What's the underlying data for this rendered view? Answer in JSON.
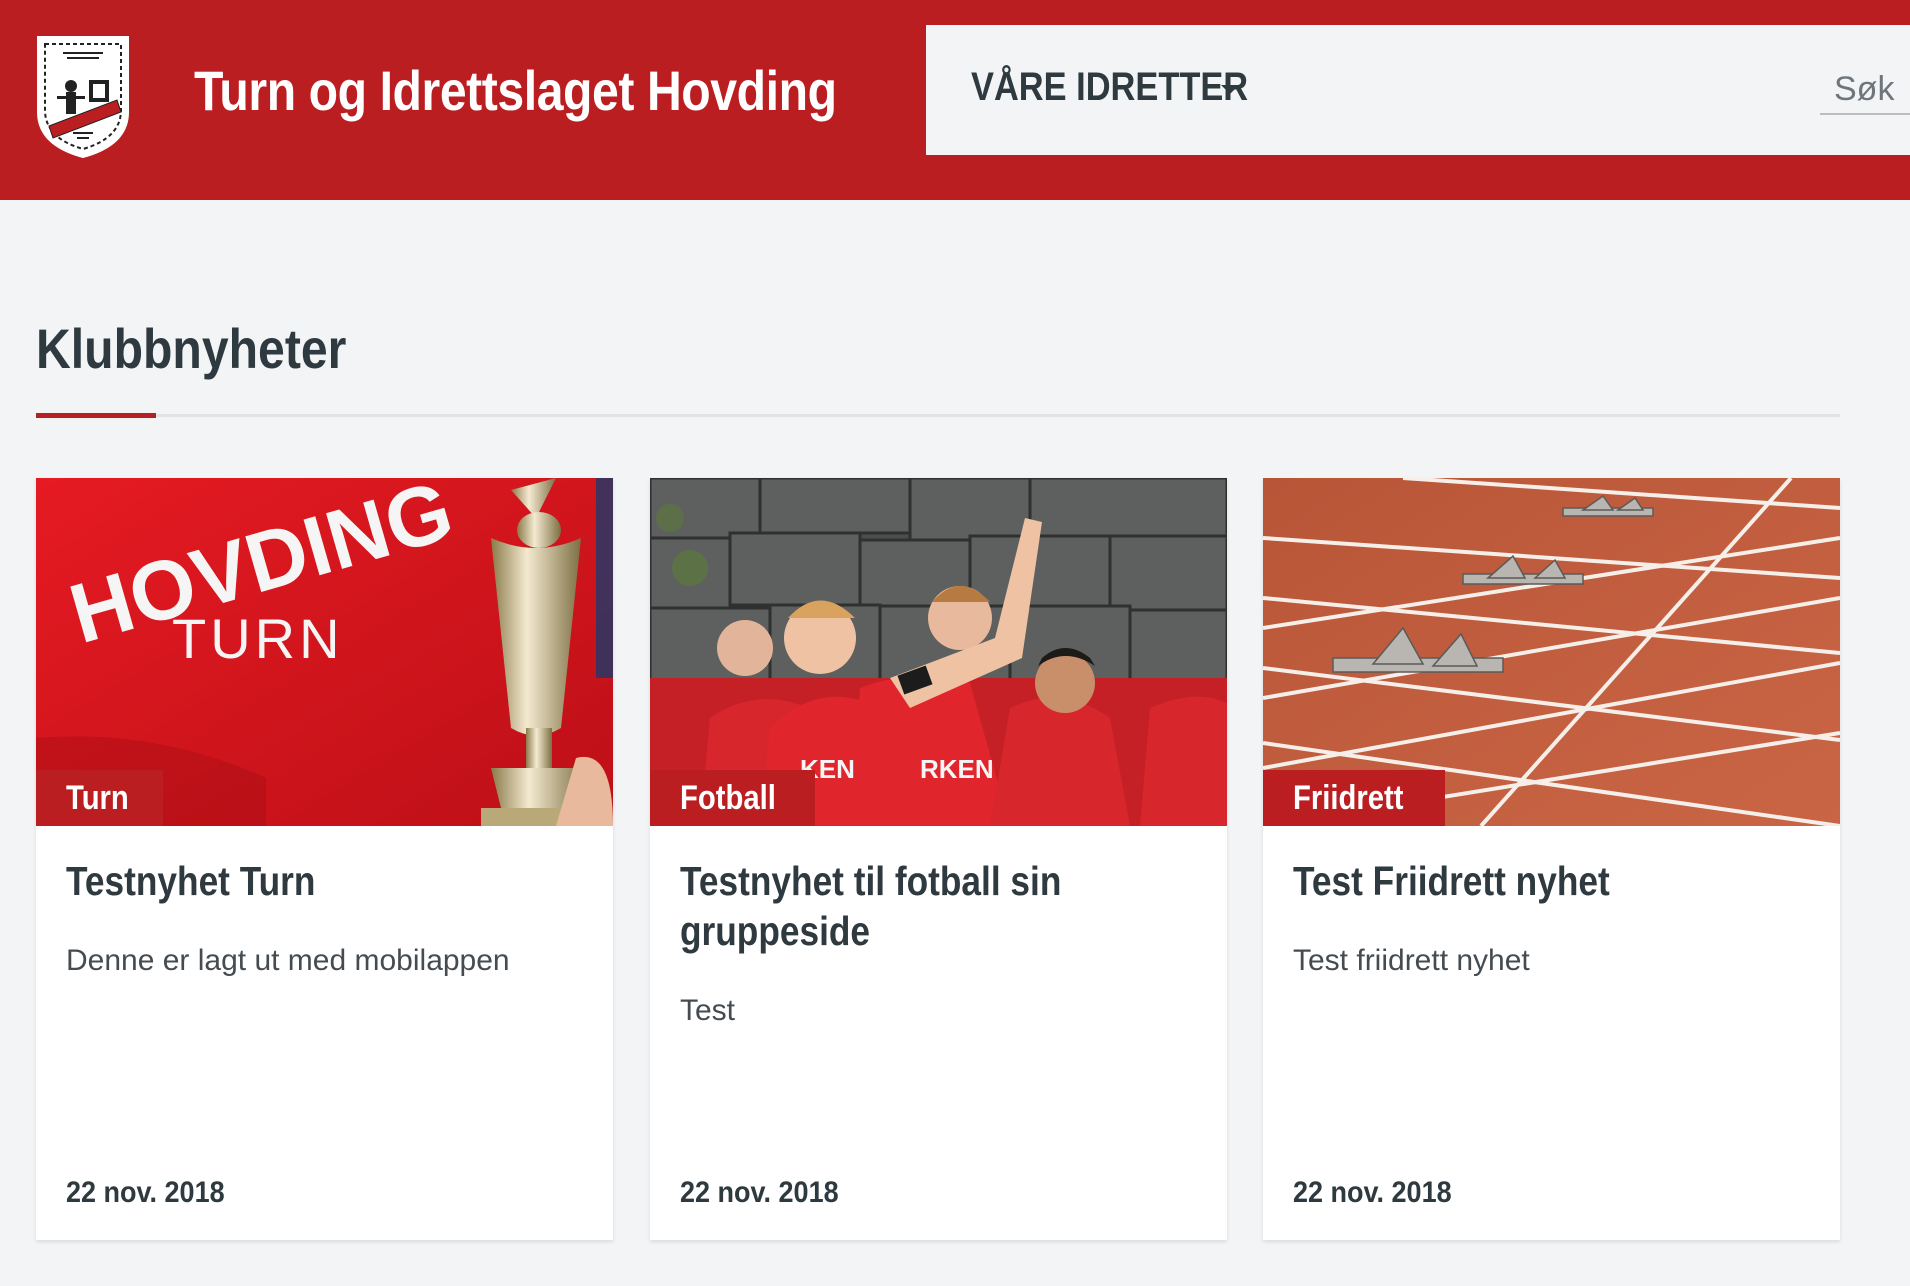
{
  "site": {
    "title": "Turn og Idrettslaget Hovding",
    "logo_icon": "club-crest-icon"
  },
  "nav": {
    "menu_label": "VÅRE IDRETTER",
    "search_placeholder": "Søk"
  },
  "section": {
    "title": "Klubbnyheter"
  },
  "colors": {
    "brand_red": "#bb1e21",
    "text_dark": "#2f3a40",
    "page_bg": "#f3f4f6"
  },
  "news": [
    {
      "tag": "Turn",
      "title": "Testnyhet Turn",
      "excerpt": "Denne er lagt ut med mobilappen",
      "date": "22 nov. 2018",
      "image": "red-jersey-with-trophy-photo",
      "image_text": [
        "HOVDING",
        "TURN"
      ]
    },
    {
      "tag": "Fotball",
      "title": "Testnyhet til fotball sin gruppeside",
      "excerpt": "Test",
      "date": "22 nov. 2018",
      "image": "football-players-celebrating-photo"
    },
    {
      "tag": "Friidrett",
      "title": "Test Friidrett nyhet",
      "excerpt": "Test friidrett nyhet",
      "date": "22 nov. 2018",
      "image": "running-track-starting-blocks-photo"
    }
  ]
}
